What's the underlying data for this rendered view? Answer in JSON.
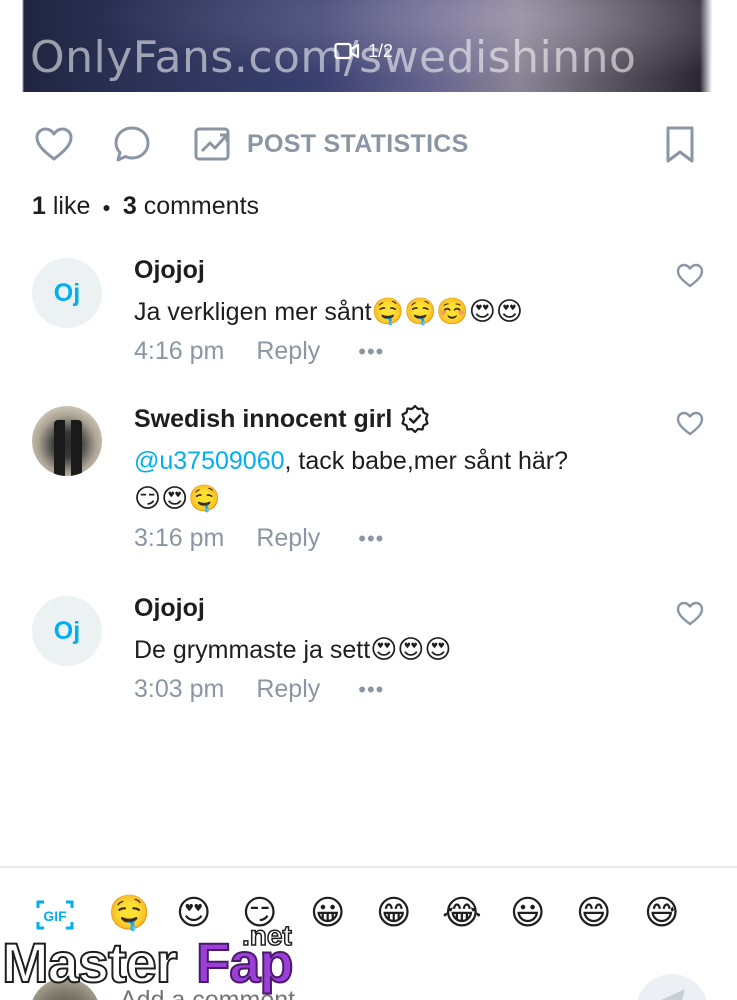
{
  "media": {
    "watermark": "OnlyFans.com/swedishinno",
    "counter": "1/2"
  },
  "actions": {
    "post_statistics_label": "POST STATISTICS"
  },
  "counts": {
    "likes_number": "1",
    "likes_label": "like",
    "comments_number": "3",
    "comments_label": "comments"
  },
  "comments": [
    {
      "avatar_initials": "Oj",
      "name": "Ojojoj",
      "text": "Ja verkligen mer sånt",
      "emojis": "🤤🤤☺️😍😍",
      "time": "4:16 pm",
      "reply_label": "Reply",
      "more_label": "•••"
    },
    {
      "name": "Swedish innocent girl",
      "mention": "@u37509060",
      "text": ", tack babe,mer sånt här?",
      "emojis": "😏😍🤤",
      "time": "3:16 pm",
      "reply_label": "Reply",
      "more_label": "•••"
    },
    {
      "avatar_initials": "Oj",
      "name": "Ojojoj",
      "text": "De grymmaste ja sett",
      "emojis": "😍😍😍",
      "time": "3:03 pm",
      "reply_label": "Reply",
      "more_label": "•••"
    }
  ],
  "emoji_bar": [
    "🤤",
    "😍",
    "😏",
    "😀",
    "😁",
    "😂",
    "😃",
    "😄",
    "😅"
  ],
  "composer": {
    "placeholder": "Add a comment"
  },
  "site_watermark": {
    "master": "Master",
    "fap": "Fap",
    "net": ".net"
  },
  "colors": {
    "accent": "#00aff0",
    "muted": "#8a96a3",
    "text": "#1e1e1e",
    "avatar_bg": "#ecf1f4"
  }
}
